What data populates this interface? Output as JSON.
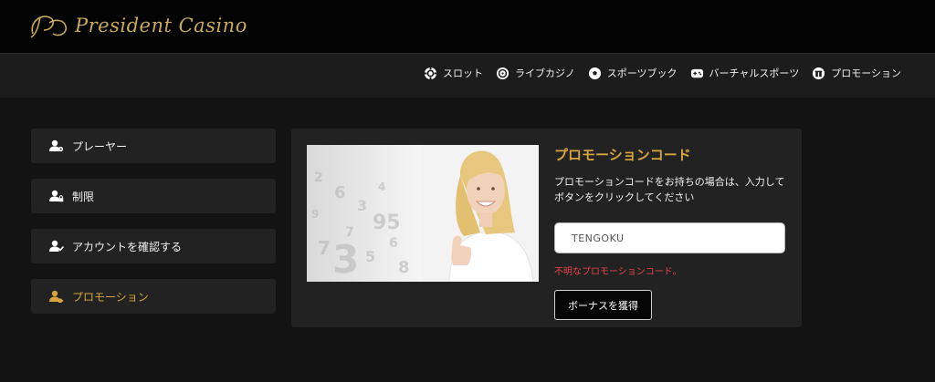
{
  "brand": {
    "logo_text": "President Casino",
    "accent_color": "#d7a53f"
  },
  "nav": {
    "items": [
      {
        "label": "スロット",
        "icon": "slot-chip-icon"
      },
      {
        "label": "ライブカジノ",
        "icon": "roulette-icon"
      },
      {
        "label": "スポーツブック",
        "icon": "soccer-ball-icon"
      },
      {
        "label": "バーチャルスポーツ",
        "icon": "gamepad-icon"
      },
      {
        "label": "プロモーション",
        "icon": "gift-icon"
      }
    ]
  },
  "sidebar": {
    "items": [
      {
        "label": "プレーヤー",
        "icon": "user-gear-icon",
        "active": false
      },
      {
        "label": "制限",
        "icon": "user-lock-icon",
        "active": false
      },
      {
        "label": "アカウントを確認する",
        "icon": "user-check-icon",
        "active": false
      },
      {
        "label": "プロモーション",
        "icon": "user-tag-icon",
        "active": true
      }
    ]
  },
  "promo": {
    "title": "プロモーションコード",
    "description": "プロモーションコードをお持ちの場合は、入力してボタンをクリックしてください",
    "code_value": "TENGOKU",
    "error": "不明なプロモーションコード。",
    "button_label": "ボーナスを獲得"
  }
}
